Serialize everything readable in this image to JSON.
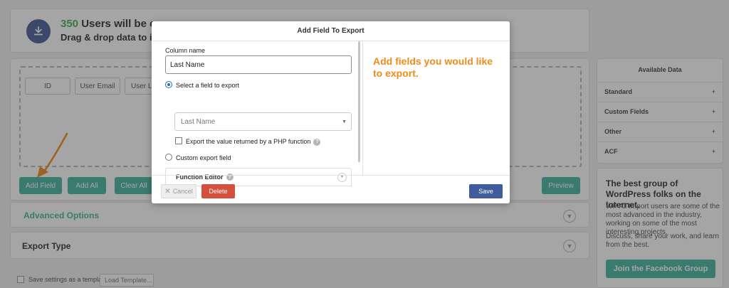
{
  "header": {
    "count": "350",
    "title_rest": " Users will be expo",
    "subtitle": "Drag & drop data to incl"
  },
  "fields": {
    "chips": [
      "ID",
      "User Email",
      "User Lo"
    ],
    "buttons": {
      "add_field": "Add Field",
      "add_all": "Add All",
      "clear_all": "Clear All",
      "preview": "Preview"
    }
  },
  "sections": {
    "advanced": "Advanced Options",
    "export_type": "Export Type"
  },
  "template": {
    "save_label": "Save settings as a template",
    "load_placeholder": "Load Template..."
  },
  "sidebar": {
    "title": "Available Data",
    "items": [
      "Standard",
      "Custom Fields",
      "Other",
      "ACF"
    ],
    "plus": "+"
  },
  "promo": {
    "heading": "The best group of WordPress folks on the Internet.",
    "p1": "WP All Import users are some of the most advanced in the industry, working on some of the most interesting projects.",
    "p2": "Discuss, share your work, and learn from the best.",
    "button": "Join the Facebook Group"
  },
  "modal": {
    "title": "Add Field To Export",
    "column_name_label": "Column name",
    "column_name_value": "Last Name",
    "select_field_label": "Select a field to export",
    "selected_field": "Last Name",
    "php_label": "Export the value returned by a PHP function",
    "custom_label": "Custom export field",
    "function_editor": "Function Editor",
    "help": "?",
    "info": "Add fields you would like to export.",
    "cancel": "Cancel",
    "delete": "Delete",
    "save": "Save"
  },
  "colors": {
    "accent_teal": "#46b7a1",
    "accent_orange": "#f08c1a",
    "delete_red": "#d64e3c",
    "save_blue": "#3f5d9e"
  }
}
